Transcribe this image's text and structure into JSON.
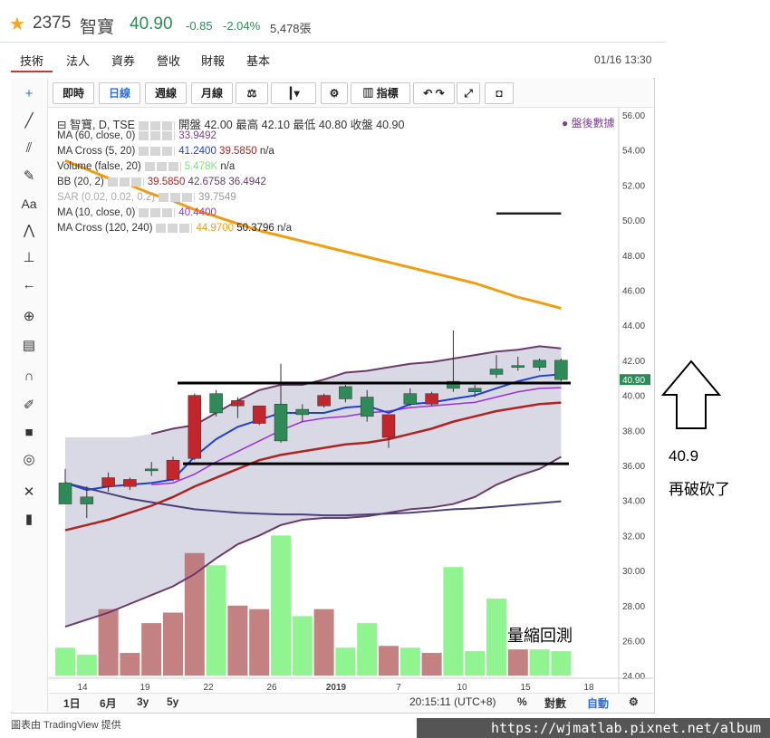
{
  "header": {
    "symbol": "2375",
    "name": "智寶",
    "price": "40.90",
    "change": "-0.85",
    "change_pct": "-2.04%",
    "volume": "5,478張"
  },
  "tabs": [
    "技術",
    "法人",
    "資券",
    "營收",
    "財報",
    "基本"
  ],
  "datetime": "01/16 13:30",
  "toolbar": [
    "即時",
    "日線",
    "週線",
    "月線",
    "指標"
  ],
  "legend": {
    "main": "智寶, D, TSE",
    "ohlc": "開盤 42.00 最高 42.10 最低 40.80 收盤 40.90",
    "after_hours": "盤後數據",
    "rows": [
      {
        "label": "MA (60, close, 0)",
        "vals": [
          "33.9492"
        ],
        "colors": [
          "#7b3f8c"
        ]
      },
      {
        "label": "MA Cross (5, 20)",
        "vals": [
          "41.2400",
          "39.5850",
          "n/a"
        ],
        "colors": [
          "#1f3fd1",
          "#b22222",
          "#333333"
        ]
      },
      {
        "label": "Volume (false, 20)",
        "vals": [
          "5.478K",
          "n/a"
        ],
        "colors": [
          "#7fe07f",
          "#333333"
        ]
      },
      {
        "label": "BB (20, 2)",
        "vals": [
          "39.5850",
          "42.6758",
          "36.4942"
        ],
        "colors": [
          "#b22222",
          "#6b3a6b",
          "#6b3a6b"
        ]
      },
      {
        "label": "SAR (0.02, 0.02, 0.2)",
        "vals": [
          "39.7549"
        ],
        "colors": [
          "#999999"
        ]
      },
      {
        "label": "MA (10, close, 0)",
        "vals": [
          "40.4400"
        ],
        "colors": [
          "#9b30d9"
        ]
      },
      {
        "label": "MA Cross (120, 240)",
        "vals": [
          "44.9700",
          "50.3796",
          "n/a"
        ],
        "colors": [
          "#f39c12",
          "#222222",
          "#333333"
        ]
      }
    ]
  },
  "bottom": {
    "ranges": [
      "1日",
      "6月",
      "3y",
      "5y"
    ],
    "time": "20:15:11 (UTC+8)",
    "pct": "%",
    "log": "對數",
    "auto": "自動"
  },
  "annotations": {
    "price": "40.9",
    "text1": "再破砍了",
    "text2": "量縮回測"
  },
  "url": "https://wjmatlab.pixnet.net/album",
  "credit": "圖表由 TradingView 提供",
  "chart_data": {
    "type": "candlestick",
    "x_tick_labels": [
      "14",
      "19",
      "22",
      "26",
      "2019",
      "7",
      "10",
      "15",
      "18"
    ],
    "y_tick_labels": [
      "56.00",
      "54.00",
      "52.00",
      "50.00",
      "48.00",
      "46.00",
      "44.00",
      "42.00",
      "40.00",
      "38.00",
      "36.00",
      "34.00",
      "32.00",
      "30.00",
      "28.00",
      "26.00",
      "24.00"
    ],
    "ylim": [
      24,
      56
    ],
    "last_price_label": "40.90",
    "candles": [
      {
        "o": 35.0,
        "h": 35.8,
        "l": 34.2,
        "c": 33.8
      },
      {
        "o": 34.2,
        "h": 34.8,
        "l": 33.0,
        "c": 33.8
      },
      {
        "o": 34.8,
        "h": 35.6,
        "l": 34.5,
        "c": 35.3
      },
      {
        "o": 34.8,
        "h": 35.3,
        "l": 34.6,
        "c": 35.2
      },
      {
        "o": 35.8,
        "h": 36.2,
        "l": 35.4,
        "c": 35.8
      },
      {
        "o": 35.2,
        "h": 36.5,
        "l": 35.1,
        "c": 36.3
      },
      {
        "o": 36.4,
        "h": 40.1,
        "l": 36.3,
        "c": 40.0
      },
      {
        "o": 40.1,
        "h": 40.3,
        "l": 38.8,
        "c": 39.0
      },
      {
        "o": 39.4,
        "h": 39.9,
        "l": 38.7,
        "c": 39.7
      },
      {
        "o": 38.4,
        "h": 39.4,
        "l": 38.3,
        "c": 39.4
      },
      {
        "o": 39.5,
        "h": 41.8,
        "l": 37.3,
        "c": 37.4
      },
      {
        "o": 39.2,
        "h": 39.5,
        "l": 38.5,
        "c": 38.9
      },
      {
        "o": 39.4,
        "h": 40.1,
        "l": 39.3,
        "c": 40.0
      },
      {
        "o": 40.5,
        "h": 40.6,
        "l": 39.6,
        "c": 39.8
      },
      {
        "o": 39.9,
        "h": 40.3,
        "l": 38.5,
        "c": 38.8
      },
      {
        "o": 37.6,
        "h": 38.9,
        "l": 37.0,
        "c": 38.9
      },
      {
        "o": 40.1,
        "h": 40.4,
        "l": 39.4,
        "c": 39.5
      },
      {
        "o": 39.5,
        "h": 40.2,
        "l": 39.4,
        "c": 40.1
      },
      {
        "o": 40.8,
        "h": 43.7,
        "l": 40.2,
        "c": 40.4
      },
      {
        "o": 40.4,
        "h": 40.6,
        "l": 39.9,
        "c": 40.2
      },
      {
        "o": 41.5,
        "h": 42.3,
        "l": 41.0,
        "c": 41.2
      },
      {
        "o": 41.7,
        "h": 42.2,
        "l": 41.4,
        "c": 41.7
      },
      {
        "o": 42.0,
        "h": 42.1,
        "l": 41.4,
        "c": 41.6
      },
      {
        "o": 42.0,
        "h": 42.1,
        "l": 40.8,
        "c": 40.9
      }
    ],
    "volume": [
      25.6,
      25.2,
      27.8,
      25.3,
      27.0,
      27.6,
      31.0,
      30.3,
      28.0,
      27.8,
      32.0,
      27.4,
      27.8,
      25.6,
      27.0,
      25.7,
      25.6,
      25.3,
      30.2,
      25.4,
      28.4,
      25.5,
      25.5,
      25.4
    ],
    "ma5": [
      35.0,
      34.6,
      34.8,
      34.9,
      35.0,
      35.2,
      36.5,
      37.5,
      38.2,
      38.6,
      39.0,
      39.0,
      39.0,
      39.3,
      39.4,
      39.0,
      39.5,
      39.6,
      39.8,
      40.0,
      40.4,
      40.8,
      41.1,
      41.2
    ],
    "ma10": [
      null,
      null,
      null,
      null,
      34.9,
      35.0,
      35.5,
      36.2,
      36.8,
      37.4,
      38.0,
      38.5,
      38.7,
      38.8,
      39.0,
      39.1,
      39.3,
      39.4,
      39.5,
      39.6,
      39.9,
      40.2,
      40.4,
      40.44
    ],
    "ma20": [
      32.3,
      32.6,
      32.9,
      33.3,
      33.7,
      34.2,
      34.8,
      35.3,
      35.8,
      36.3,
      36.6,
      36.8,
      37.0,
      37.2,
      37.3,
      37.5,
      37.8,
      38.1,
      38.5,
      38.8,
      39.1,
      39.3,
      39.5,
      39.585
    ],
    "ma60": [
      35.0,
      34.7,
      34.4,
      34.1,
      33.9,
      33.7,
      33.5,
      33.4,
      33.3,
      33.25,
      33.2,
      33.2,
      33.15,
      33.15,
      33.2,
      33.25,
      33.3,
      33.4,
      33.5,
      33.55,
      33.65,
      33.75,
      33.85,
      33.95
    ],
    "bb_upper": [
      null,
      null,
      null,
      null,
      37.8,
      38.1,
      38.3,
      39.0,
      39.7,
      40.3,
      40.6,
      40.6,
      40.9,
      41.3,
      41.4,
      41.6,
      41.8,
      41.9,
      42.1,
      42.3,
      42.5,
      42.6,
      42.8,
      42.68
    ],
    "bb_lower": [
      26.8,
      27.2,
      27.6,
      28.1,
      28.6,
      29.1,
      29.8,
      30.7,
      31.5,
      32.0,
      32.6,
      32.9,
      33.0,
      33.0,
      33.1,
      33.3,
      33.5,
      33.6,
      33.8,
      34.2,
      34.9,
      35.4,
      35.8,
      36.49
    ],
    "ma120": [
      53.4,
      52.9,
      52.4,
      52.0,
      51.5,
      51.1,
      50.6,
      50.2,
      49.8,
      49.4,
      49.1,
      48.8,
      48.5,
      48.2,
      47.9,
      47.6,
      47.3,
      47.0,
      46.7,
      46.4,
      46.0,
      45.6,
      45.3,
      44.97
    ],
    "ma240": [
      50.38,
      50.38,
      50.38
    ],
    "hlines": [
      40.7,
      36.1
    ]
  }
}
